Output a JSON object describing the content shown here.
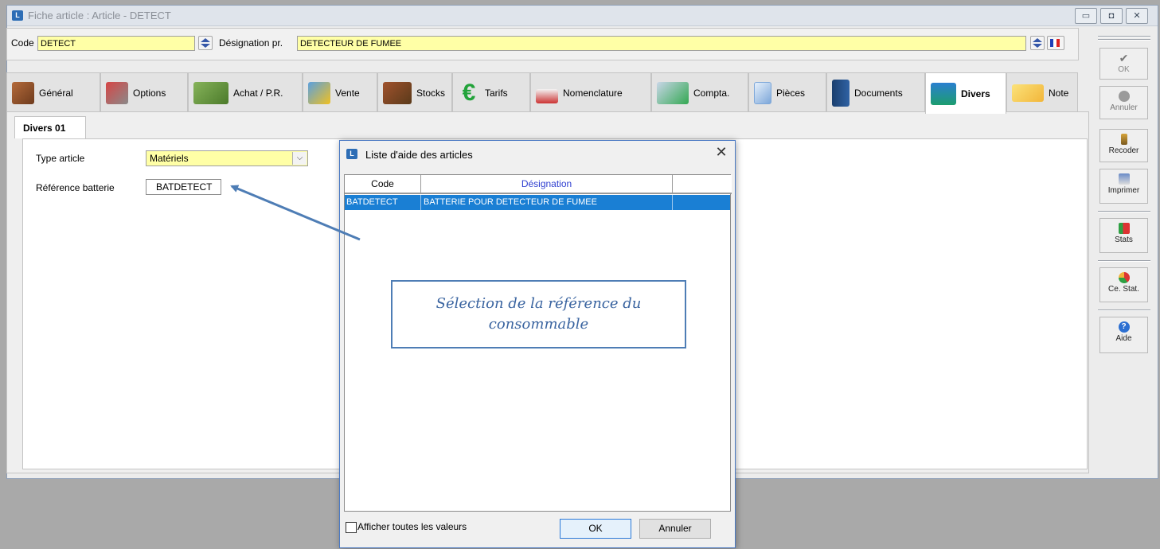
{
  "window": {
    "title": "Fiche article : Article - DETECT",
    "controls": [
      "minimize-icon",
      "maximize-icon",
      "close-icon"
    ]
  },
  "header": {
    "code_label": "Code",
    "code_value": "DETECT",
    "designation_label": "Désignation pr.",
    "designation_value": "DETECTEUR DE FUMEE"
  },
  "tabs": [
    {
      "label": "Général",
      "icon": "box-icon"
    },
    {
      "label": "Options",
      "icon": "options-icon"
    },
    {
      "label": "Achat / P.R.",
      "icon": "basket-icon"
    },
    {
      "label": "Vente",
      "icon": "document-gear-icon"
    },
    {
      "label": "Stocks",
      "icon": "stock-boxes-icon"
    },
    {
      "label": "Tarifs",
      "icon": "euro-icon"
    },
    {
      "label": "Nomenclature",
      "icon": "nomenclature-icon"
    },
    {
      "label": "Compta.",
      "icon": "accounting-icon"
    },
    {
      "label": "Pièces",
      "icon": "pages-icon"
    },
    {
      "label": "Documents",
      "icon": "book-icon"
    },
    {
      "label": "Divers",
      "icon": "calculator-icon",
      "active": true
    },
    {
      "label": "Note",
      "icon": "note-icon"
    }
  ],
  "subtab": {
    "label": "Divers 01"
  },
  "form": {
    "type_label": "Type article",
    "type_value": "Matériels",
    "ref_label": "Référence batterie",
    "ref_value": "BATDETECT"
  },
  "toolbar": {
    "ok": "OK",
    "annuler": "Annuler",
    "recoder": "Recoder",
    "imprimer": "Imprimer",
    "stats": "Stats",
    "ce_stat": "Ce. Stat.",
    "aide": "Aide"
  },
  "dialog": {
    "title": "Liste d'aide des articles",
    "columns": [
      "Code",
      "Désignation"
    ],
    "rows": [
      {
        "code": "BATDETECT",
        "designation": "BATTERIE POUR DETECTEUR DE FUMEE"
      }
    ],
    "checkbox_label": "Afficher toutes les valeurs",
    "ok_button": "OK",
    "cancel_button": "Annuler"
  },
  "annotation": {
    "line1": "Sélection de la référence du",
    "line2": "consommable"
  },
  "colors": {
    "field_yellow": "#ffffa6",
    "selection_blue": "#1a7fd4",
    "callout_border": "#4e7db5",
    "header_blue": "#2f3fd0"
  }
}
